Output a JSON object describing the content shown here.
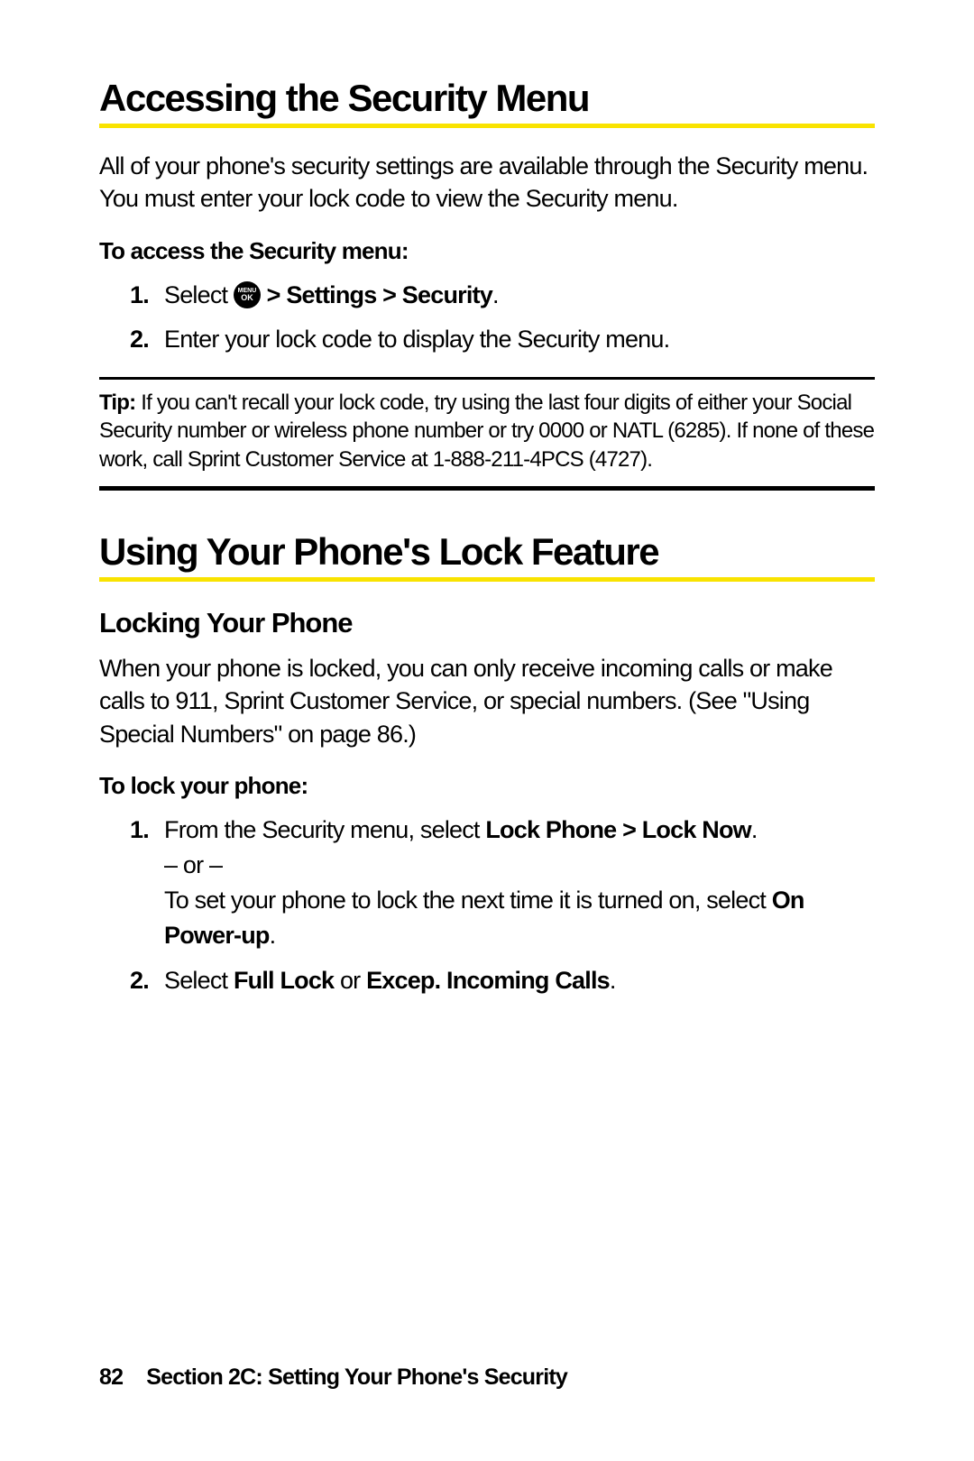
{
  "section1": {
    "heading": "Accessing the Security Menu",
    "intro": "All of your phone's security settings are available through the Security menu. You must enter your lock code to view the Security menu.",
    "procLabel": "To access the Security menu:",
    "step1_prefix": "Select ",
    "step1_icon_top": "MENU",
    "step1_icon_bottom": "OK",
    "step1_suffix_bold": " > Settings > Security",
    "step1_period": ".",
    "step2": "Enter your lock code to display the Security menu."
  },
  "tip": {
    "label": "Tip:",
    "text": " If you can't recall your lock code, try using the last four digits of either your Social Security number or wireless phone number or try 0000 or NATL (6285). If none of these work, call Sprint Customer Service at 1-888-211-4PCS (4727)."
  },
  "section2": {
    "heading": "Using Your Phone's Lock Feature",
    "subheading": "Locking Your Phone",
    "intro": "When your phone is locked, you can only receive incoming calls or make calls to 911, Sprint Customer Service, or special numbers. (See \"Using Special Numbers\" on page 86.)",
    "procLabel": "To lock your phone:",
    "step1_line1_a": "From the Security menu, select ",
    "step1_line1_b": "Lock Phone > Lock Now",
    "step1_line1_c": ".",
    "step1_line2": "– or –",
    "step1_line3_a": "To set your phone to lock the next time it is turned on, select ",
    "step1_line3_b": "On Power-up",
    "step1_line3_c": ".",
    "step2_a": "Select ",
    "step2_b": "Full Lock",
    "step2_c": " or ",
    "step2_d": "Excep. Incoming Calls",
    "step2_e": "."
  },
  "footer": {
    "page": "82",
    "label": "Section 2C: Setting Your Phone's Security"
  }
}
